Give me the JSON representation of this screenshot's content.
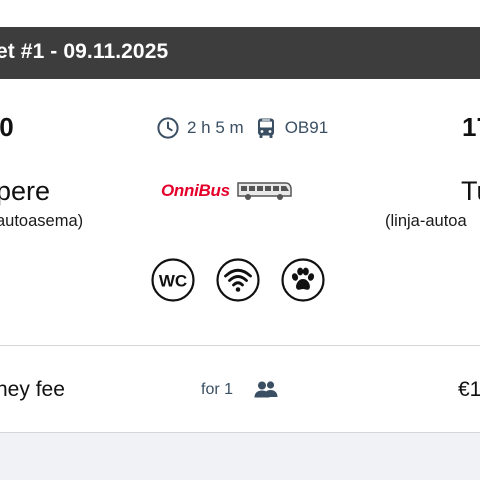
{
  "header": {
    "title": "et #1 - 09.11.2025"
  },
  "trip": {
    "departure_time": ".0",
    "arrival_time": "17",
    "duration": "2 h 5 m",
    "route_code": "OB91",
    "departure_city": "pere",
    "arrival_city": "Tu",
    "departure_station": "autoasema)",
    "arrival_station": "(linja-autoa",
    "operator": "OnniBus",
    "amenities": [
      {
        "name": "wc",
        "label": "WC"
      },
      {
        "name": "wifi",
        "label": ""
      },
      {
        "name": "pets",
        "label": ""
      }
    ]
  },
  "fee": {
    "label": "ney fee",
    "for_text": "for 1",
    "price": "€1"
  },
  "colors": {
    "header_bg": "#3d3d3d",
    "brand_red": "#e4002b",
    "meta_text": "#3a4f63",
    "footer_bg": "#f0f2f5"
  }
}
